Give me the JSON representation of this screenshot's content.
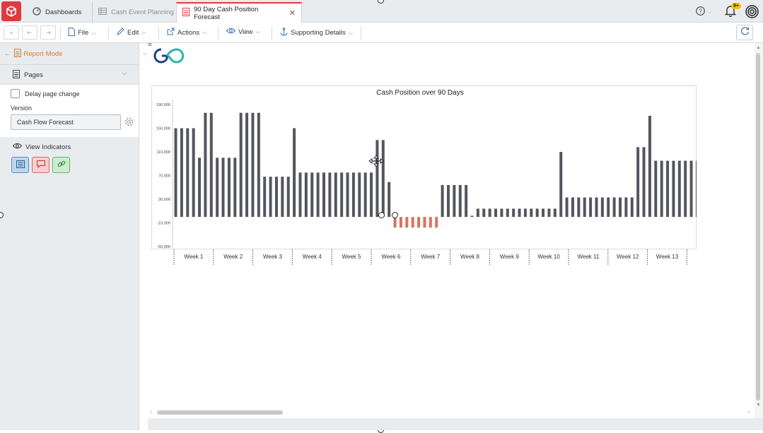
{
  "tabs": {
    "dashboards": "Dashboards",
    "cash_event_planning": "Cash Event Planning",
    "forecast": "90 Day Cash Position Forecast"
  },
  "header": {
    "help": "?",
    "notifications_badge": "9+"
  },
  "toolbar": {
    "file": "File",
    "edit": "Edit",
    "actions": "Actions",
    "view": "View",
    "supporting_details": "Supporting Details"
  },
  "sidebar": {
    "report_mode": "Report Mode",
    "pages": "Pages",
    "delay_page_change": "Delay page change",
    "version_label": "Version",
    "version_value": "Cash Flow Forecast",
    "view_indicators": "View Indicators"
  },
  "colors": {
    "accent": "#e0393e",
    "report_mode": "#e07a2f",
    "bar_positive": "#54555e",
    "bar_negative": "#d9735a"
  },
  "icons": [
    "app-logo-icon",
    "dashboard-icon",
    "sheet-icon",
    "report-icon",
    "help-icon",
    "bell-icon",
    "target-icon",
    "first-page-icon",
    "prev-page-icon",
    "next-page-icon",
    "file-icon",
    "pencil-icon",
    "external-link-icon",
    "eye-icon",
    "anchor-icon",
    "refresh-icon",
    "report-mode-icon",
    "pages-icon",
    "gear-icon",
    "comment-icon",
    "link-icon",
    "logo-icon"
  ],
  "chart_data": {
    "type": "bar",
    "title": "Cash Position over 90 Days",
    "yticks": [
      "190,000",
      "150,000",
      "110,000",
      "70,000",
      "30,000",
      "-10,000",
      "-50,000"
    ],
    "ylim": [
      -50000,
      190000
    ],
    "weeks": [
      "Week 1",
      "Week 2",
      "Week 3",
      "Week 4",
      "Week 5",
      "Week 6",
      "Week 7",
      "Week 8",
      "Week 9",
      "Week 10",
      "Week 11",
      "Week 12",
      "Week 13"
    ],
    "values": [
      150000,
      150000,
      150000,
      150000,
      100000,
      176000,
      176000,
      100000,
      100000,
      100000,
      100000,
      176000,
      176000,
      176000,
      176000,
      68000,
      68000,
      68000,
      68000,
      68000,
      150000,
      75000,
      75000,
      75000,
      75000,
      75000,
      75000,
      75000,
      75000,
      75000,
      75000,
      75000,
      75000,
      75000,
      130000,
      130000,
      59000,
      -18000,
      -18000,
      -18000,
      -18000,
      -18000,
      -18000,
      -18000,
      -18000,
      54000,
      54000,
      54000,
      54000,
      54000,
      2000,
      14000,
      14000,
      14000,
      14000,
      14000,
      14000,
      14000,
      14000,
      14000,
      14000,
      14000,
      14000,
      14000,
      14000,
      110000,
      33000,
      33000,
      33000,
      33000,
      33000,
      33000,
      33000,
      33000,
      33000,
      33000,
      33000,
      33000,
      118000,
      118000,
      171000,
      95000,
      95000,
      95000,
      95000,
      95000,
      95000,
      95000,
      95000,
      95000
    ]
  }
}
